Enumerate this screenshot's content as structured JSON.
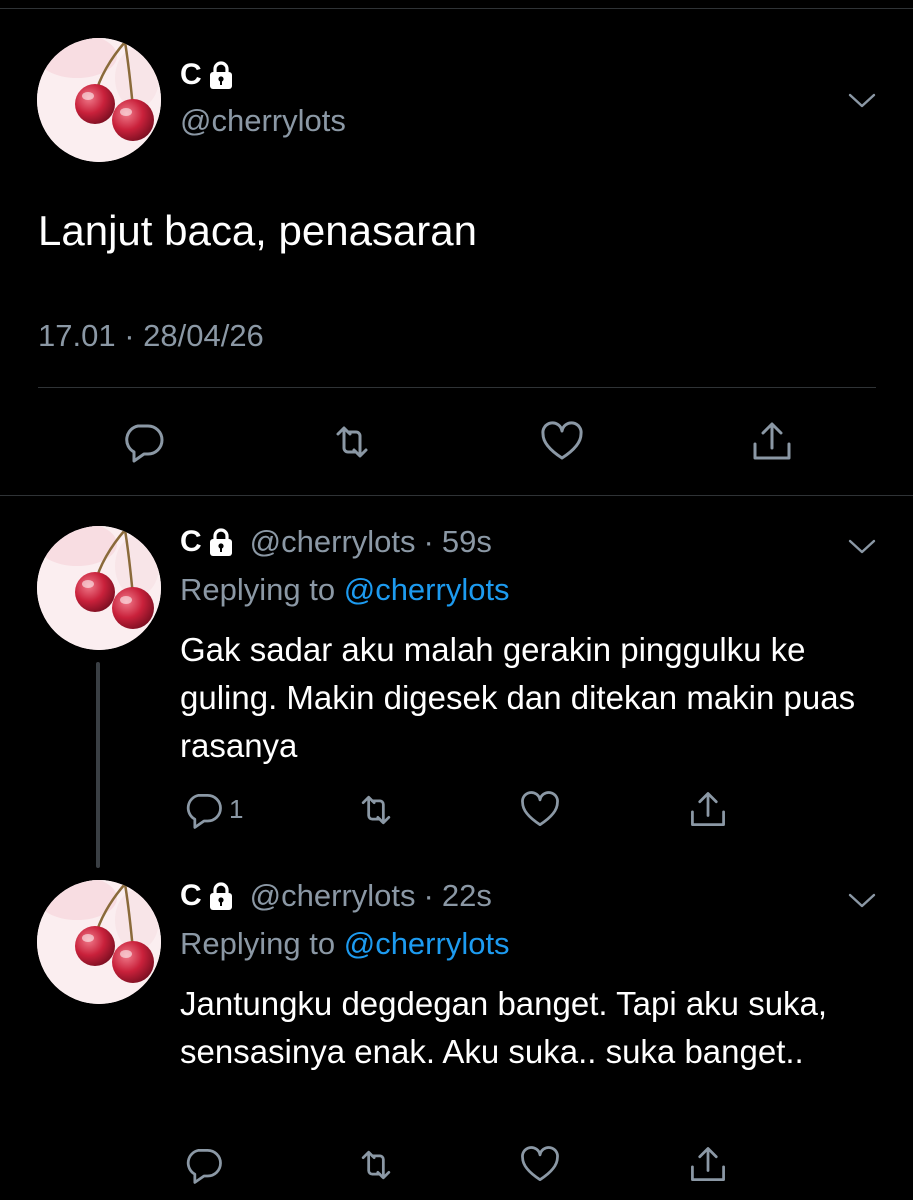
{
  "main_tweet": {
    "display_name": "C",
    "handle": "@cherrylots",
    "text": "Lanjut baca, penasaran",
    "timestamp": "17.01 · 28/04/26",
    "avatar_icon": "cherries-avatar",
    "actions": [
      "reply-icon",
      "retweet-icon",
      "like-icon",
      "share-icon"
    ]
  },
  "replies": [
    {
      "display_name": "C",
      "handle": "@cherrylots",
      "separator": "·",
      "time": "59s",
      "replying_prefix": "Replying to",
      "replying_to": "@cherrylots",
      "text": "Gak sadar aku malah gerakin pinggulku ke guling. Makin digesek dan ditekan makin puas rasanya",
      "reply_count": "1"
    },
    {
      "display_name": "C",
      "handle": "@cherrylots",
      "separator": "·",
      "time": "22s",
      "replying_prefix": "Replying to",
      "replying_to": "@cherrylots",
      "text": "Jantungku degdegan banget. Tapi aku suka, sensasinya enak. Aku suka.. suka banget..",
      "reply_count": ""
    }
  ],
  "colors": {
    "background": "#000000",
    "primary_text": "#ffffff",
    "secondary_text": "#8b98a5",
    "link": "#1d9bf0",
    "divider": "#2f3336"
  }
}
